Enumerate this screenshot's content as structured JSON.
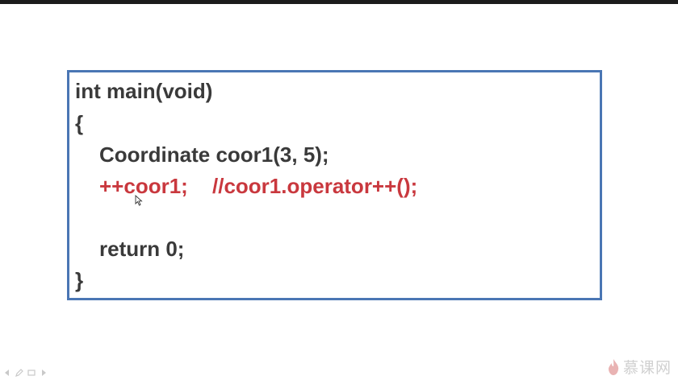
{
  "slide": {
    "code_lines": [
      "int main(void)",
      "{",
      "Coordinate coor1(3, 5);",
      "++coor1;",
      "//coor1.operator++();",
      "return 0;",
      "}"
    ]
  },
  "watermark": {
    "text": "慕课网",
    "logo_icon": "flame-logo-icon"
  },
  "player_controls": {
    "icons": [
      "prev-icon",
      "pen-icon",
      "menu-icon",
      "next-icon"
    ]
  },
  "colors": {
    "border": "#4a76b4",
    "code_text": "#3a3a3a",
    "highlight": "#c9383e",
    "top_bar": "#1b1b1b"
  }
}
